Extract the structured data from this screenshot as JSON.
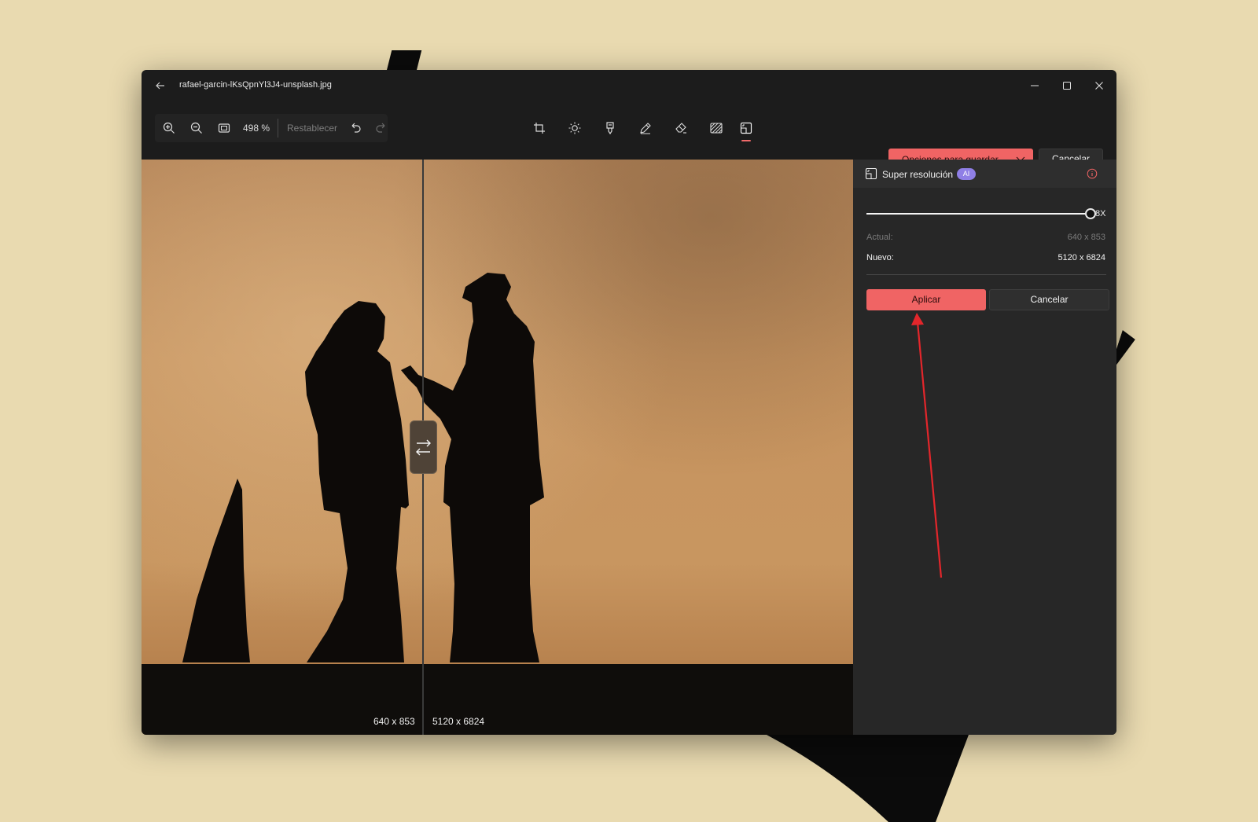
{
  "window": {
    "file_name": "rafael-garcin-lKsQpnYl3J4-unsplash.jpg"
  },
  "toolbar": {
    "zoom_level": "498 %",
    "reset_label": "Restablecer",
    "save_options_label": "Opciones para guardar",
    "cancel_label": "Cancelar"
  },
  "canvas": {
    "left_dimensions": "640 x 853",
    "right_dimensions": "5120 x 6824"
  },
  "panel": {
    "title": "Super resolución",
    "ai_badge": "AI",
    "slider_value_label": "8X",
    "slider_level_fraction": 1.0,
    "actual_label": "Actual:",
    "actual_value": "640 x 853",
    "new_label": "Nuevo:",
    "new_value": "5120 x 6824",
    "apply_label": "Aplicar",
    "cancel_label": "Cancelar"
  },
  "colors": {
    "accent": "#f06464",
    "annotation_arrow": "#e3262b",
    "desktop_background": "#e9dab0"
  },
  "icons": [
    "back-arrow-icon",
    "minimize-icon",
    "maximize-icon",
    "close-icon",
    "zoom-in-icon",
    "zoom-out-icon",
    "fit-screen-icon",
    "undo-icon",
    "redo-icon",
    "crop-icon",
    "brightness-icon",
    "filter-icon",
    "markup-icon",
    "erase-icon",
    "blur-background-icon",
    "super-resolution-icon",
    "chevron-down-icon",
    "swap-icon",
    "info-icon"
  ]
}
